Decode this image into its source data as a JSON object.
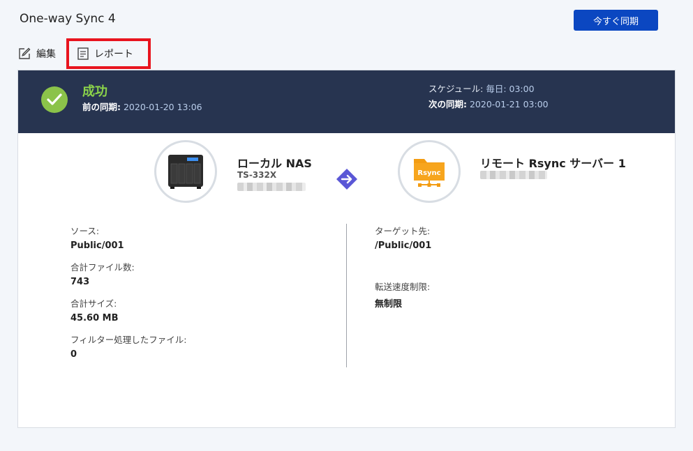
{
  "header": {
    "title": "One-way Sync 4",
    "sync_now_label": "今すぐ同期"
  },
  "toolbar": {
    "edit_label": "編集",
    "report_label": "レポート"
  },
  "status": {
    "result": "成功",
    "last_sync_label": "前の同期:",
    "last_sync_value": "2020-01-20 13:06",
    "schedule_label": "スケジュール:",
    "schedule_value": "毎日: 03:00",
    "next_sync_label": "次の同期:",
    "next_sync_value": "2020-01-21 03:00",
    "success_color": "#8bc34a"
  },
  "source_device": {
    "name": "ローカル NAS",
    "model": "TS-332X",
    "icon": "nas-device-icon"
  },
  "target_device": {
    "name": "リモート Rsync サーバー 1",
    "icon_text": "Rsync",
    "icon": "rsync-folder-icon"
  },
  "details": {
    "source_label": "ソース:",
    "source_value": "Public/001",
    "total_files_label": "合計ファイル数:",
    "total_files_value": "743",
    "total_size_label": "合計サイズ:",
    "total_size_value": "45.60 MB",
    "filtered_label": "フィルター処理したファイル:",
    "filtered_value": "0",
    "target_label": "ターゲット先:",
    "target_value": "/Public/001",
    "speed_limit_label": "転送速度制限:",
    "speed_limit_value": "無制限"
  },
  "colors": {
    "banner": "#273450",
    "primary_button": "#0b47c1",
    "highlight": "#e8141e"
  }
}
